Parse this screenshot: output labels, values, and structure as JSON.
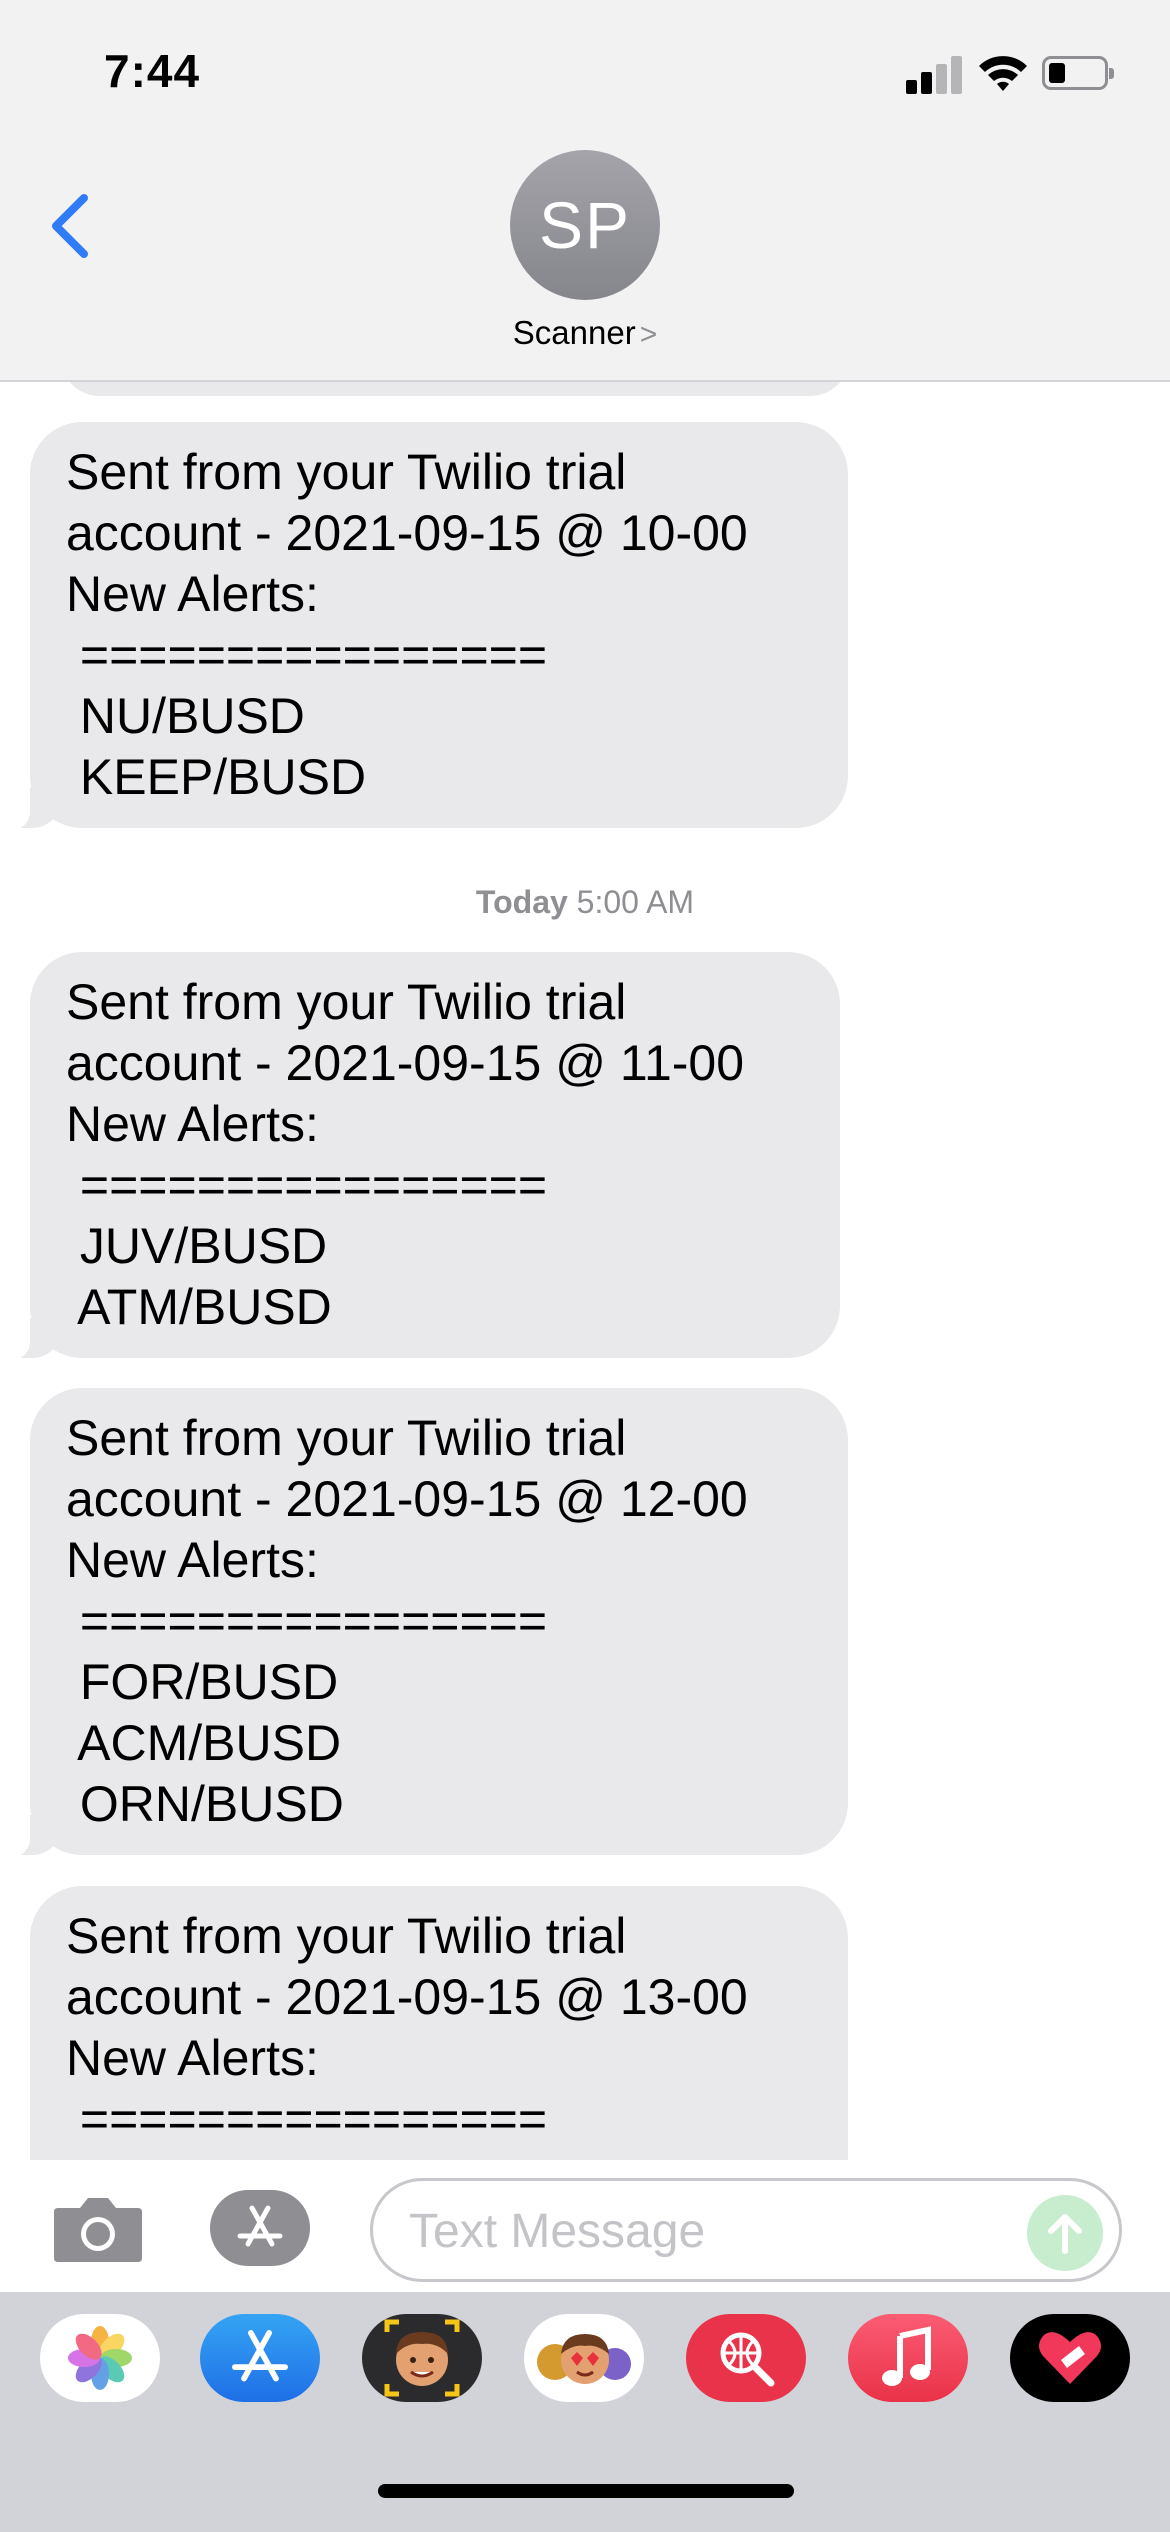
{
  "status_bar": {
    "time": "7:44"
  },
  "header": {
    "avatar_initials": "SP",
    "contact_name": "Scanner",
    "contact_chevron": ">"
  },
  "thread": {
    "timestamp": {
      "day": "Today",
      "time": "5:00 AM"
    },
    "messages": [
      {
        "lines": [
          "Sent from your Twilio trial",
          "account - 2021-09-15 @ 10-00",
          "New Alerts:",
          " ================",
          " NU/BUSD",
          " KEEP/BUSD"
        ]
      },
      {
        "lines": [
          "Sent from your Twilio trial",
          "account - 2021-09-15 @ 11-00",
          "New Alerts:",
          " ================",
          " JUV/BUSD",
          " ATM/BUSD"
        ]
      },
      {
        "lines": [
          "Sent from your Twilio trial",
          "account - 2021-09-15 @ 12-00",
          "New Alerts:",
          " ================",
          " FOR/BUSD",
          " ACM/BUSD",
          " ORN/BUSD"
        ]
      },
      {
        "lines": [
          "Sent from your Twilio trial",
          "account - 2021-09-15 @ 13-00",
          "New Alerts:",
          " ================"
        ]
      }
    ]
  },
  "composer": {
    "placeholder": "Text Message"
  },
  "drawer": {
    "apps": [
      "photos-icon",
      "app-store-icon",
      "memoji-icon",
      "animoji-stickers-icon",
      "web-images-icon",
      "music-icon",
      "heart-app-icon"
    ]
  }
}
